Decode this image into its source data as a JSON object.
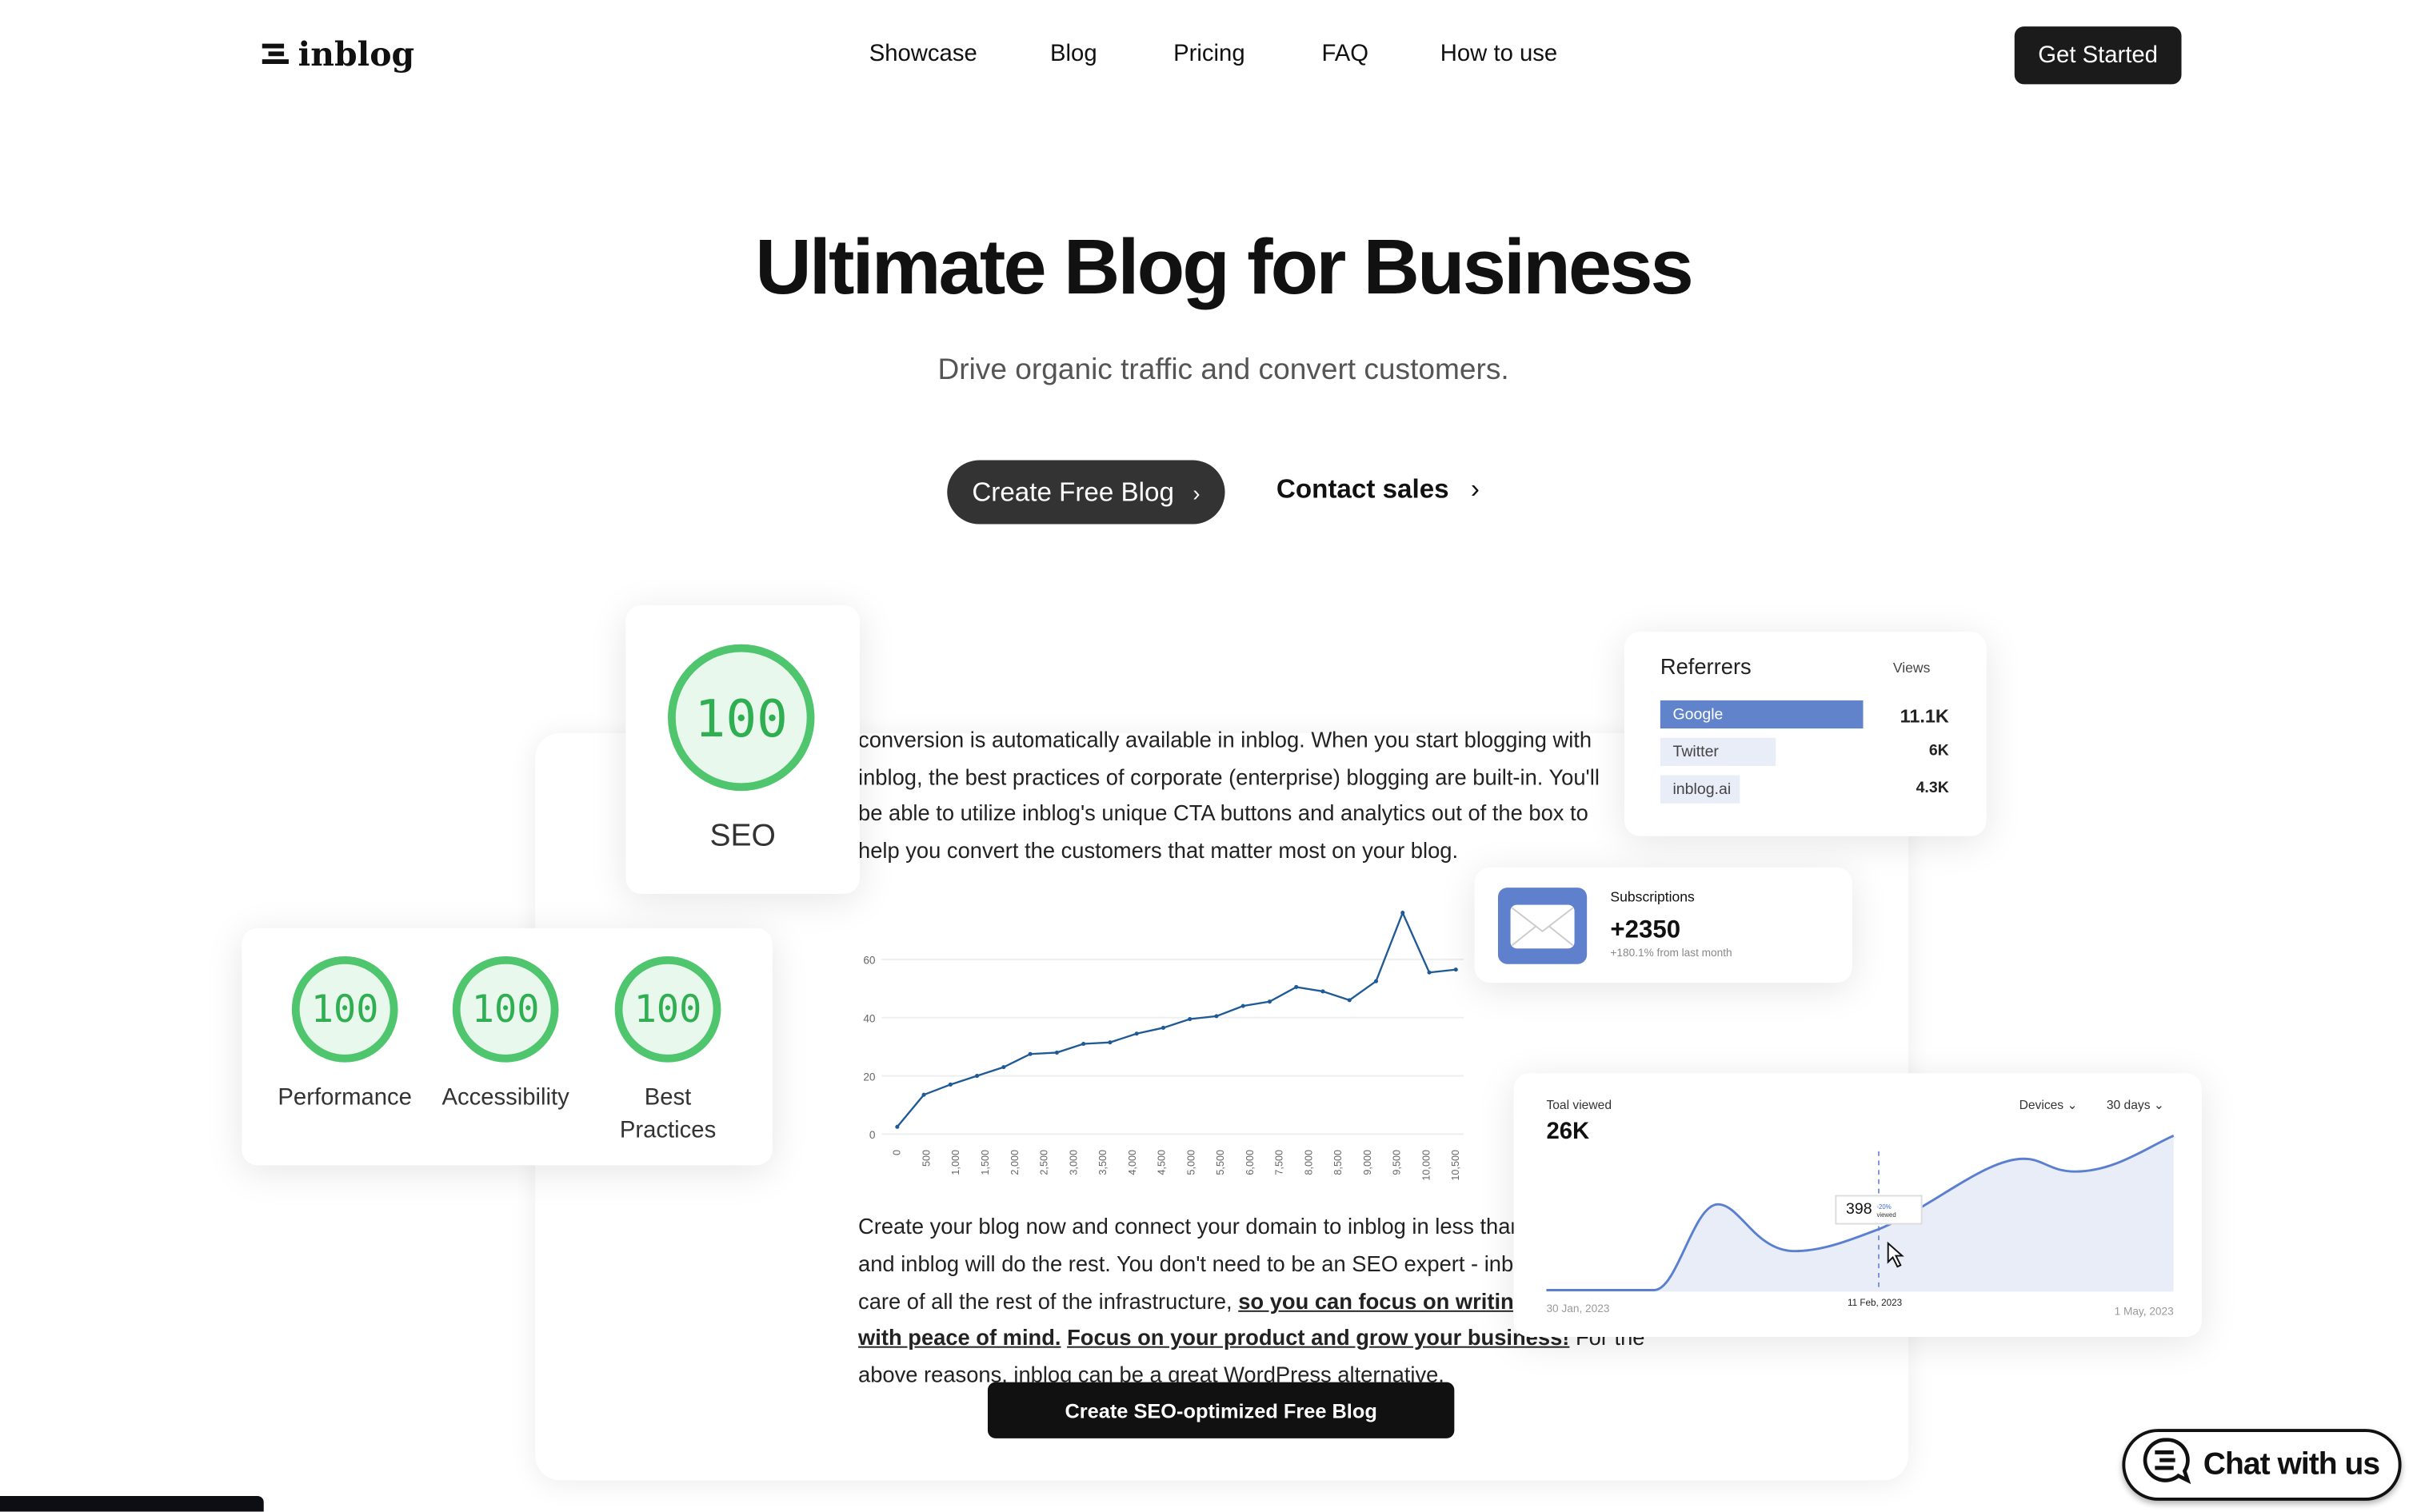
{
  "header": {
    "logo": "inblog",
    "nav": [
      "Showcase",
      "Blog",
      "Pricing",
      "FAQ",
      "How to use"
    ],
    "cta": "Get Started"
  },
  "hero": {
    "title": "Ultimate Blog for Business",
    "subtitle": "Drive organic traffic and convert customers.",
    "primary_button": "Create Free Blog",
    "secondary_button": "Contact sales"
  },
  "scores": {
    "seo": {
      "value": "100",
      "label": "SEO"
    },
    "items": [
      {
        "value": "100",
        "label": "Performance"
      },
      {
        "value": "100",
        "label": "Accessibility"
      },
      {
        "value": "100",
        "label": "Best Practices"
      }
    ],
    "color": "#4fc56e"
  },
  "article": {
    "para1": [
      "conversion is automatically available in inblog. When you start blogging with",
      "inblog, the best practices of corporate (enterprise) blogging are built-in. You'll",
      "be able to utilize inblog's unique CTA buttons and analytics out of the box to",
      "help you convert the customers that matter most on your blog."
    ],
    "para2": {
      "line1": "Create your blog now and connect your domain to inblog in less than a",
      "line2": "and inblog will do the rest. You don't need to be an SEO expert - inblog",
      "line3_plain": "care of all the rest of the infrastructure, ",
      "line3_bold": "so you can focus on writing co",
      "line4_bold1": "with peace of mind.",
      "line4_bold2": "Focus on your product and grow your business!",
      "line4_plain": " For the",
      "line5": "above reasons, inblog can be a great WordPress alternative."
    },
    "cta": "Create SEO-optimized Free Blog"
  },
  "chart_data": [
    {
      "type": "line",
      "x_tick_labels": [
        "0",
        "500",
        "1,000",
        "1,500",
        "2,000",
        "2,500",
        "3,000",
        "3,500",
        "4,000",
        "4,500",
        "5,000",
        "5,500",
        "6,000",
        "7,500",
        "8,000",
        "8,500",
        "9,000",
        "9,500",
        "10,000",
        "10,500"
      ],
      "values": [
        2.5,
        13.5,
        17,
        20,
        23,
        27.5,
        28,
        31,
        31.5,
        34.5,
        36.5,
        39.5,
        40.5,
        44,
        45.5,
        50.5,
        49,
        46,
        52.5,
        76,
        55.5,
        56.5
      ],
      "y_ticks": [
        0,
        20,
        40,
        60
      ],
      "ylim": [
        0,
        60
      ],
      "grid": true,
      "color": "#1f5a96"
    },
    {
      "type": "area",
      "label": "Toal viewed",
      "total": "26K",
      "filters": [
        "Devices",
        "30 days"
      ],
      "x_labels": [
        "30 Jan, 2023",
        "11 Feb, 2023",
        "1 May, 2023"
      ],
      "tooltip": {
        "value": "398",
        "change": "-20%",
        "unit": "viewed",
        "date": "11 Feb, 2023"
      },
      "color": "#5b7fd0",
      "fill": "#e8edf8"
    }
  ],
  "referrers": {
    "title": "Referrers",
    "column": "Views",
    "rows": [
      {
        "name": "Google",
        "views": "11.1K",
        "share": 1.0
      },
      {
        "name": "Twitter",
        "views": "6K",
        "share": 0.57
      },
      {
        "name": "inblog.ai",
        "views": "4.3K",
        "share": 0.39
      }
    ]
  },
  "subscriptions": {
    "label": "Subscriptions",
    "value": "+2350",
    "change": "+180.1% from last month",
    "icon_color": "#5f80cc"
  },
  "chat": {
    "label": "Chat with us"
  }
}
